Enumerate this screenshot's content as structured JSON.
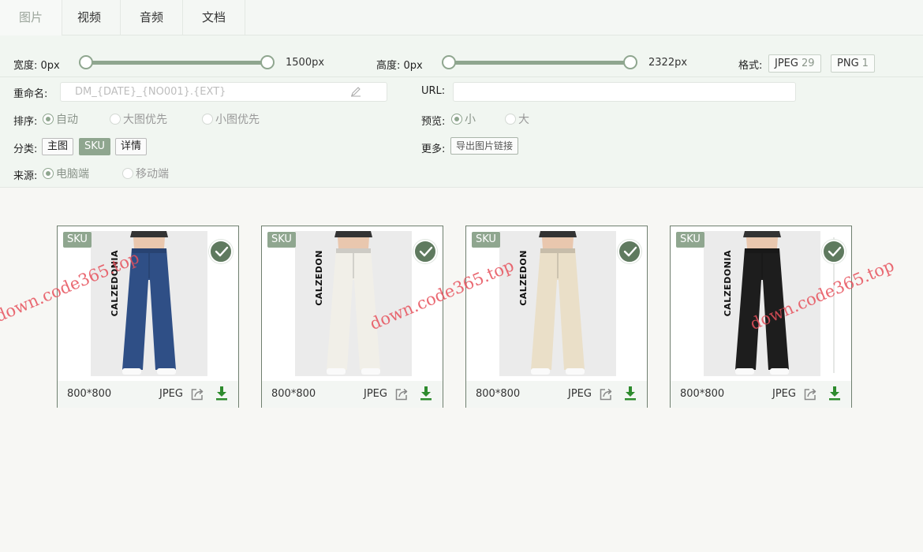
{
  "tabs": [
    {
      "label": "图片",
      "active": true
    },
    {
      "label": "视频",
      "active": false
    },
    {
      "label": "音频",
      "active": false
    },
    {
      "label": "文档",
      "active": false
    }
  ],
  "filters": {
    "width": {
      "label": "宽度: 0px",
      "max_label": "1500px",
      "min": 0,
      "max": 1500
    },
    "height": {
      "label": "高度: 0px",
      "max_label": "2322px",
      "min": 0,
      "max": 2322
    },
    "format": {
      "label": "格式:",
      "options": [
        {
          "name": "JPEG",
          "count": "29"
        },
        {
          "name": "PNG",
          "count": "1"
        }
      ]
    },
    "rename": {
      "label": "重命名:",
      "placeholder": "DM_{DATE}_{NO001}.{EXT}"
    },
    "url": {
      "label": "URL:",
      "value": ""
    },
    "sort": {
      "label": "排序:",
      "options": [
        {
          "label": "自动",
          "selected": true
        },
        {
          "label": "大图优先",
          "selected": false
        },
        {
          "label": "小图优先",
          "selected": false
        }
      ]
    },
    "preview": {
      "label": "预览:",
      "options": [
        {
          "label": "小",
          "selected": true
        },
        {
          "label": "大",
          "selected": false
        }
      ]
    },
    "category": {
      "label": "分类:",
      "options": [
        {
          "label": "主图",
          "active": false
        },
        {
          "label": "SKU",
          "active": true
        },
        {
          "label": "详情",
          "active": false
        }
      ]
    },
    "more": {
      "label": "更多:",
      "export_label": "导出图片链接"
    },
    "source": {
      "label": "来源:",
      "options": [
        {
          "label": "电脑端",
          "selected": true
        },
        {
          "label": "移动端",
          "selected": false
        }
      ]
    }
  },
  "images": [
    {
      "tag": "SKU",
      "brand": "CALZEDONIA",
      "dimensions": "800*800",
      "type": "JPEG",
      "checked": true,
      "pants_color": "#2f4f86"
    },
    {
      "tag": "SKU",
      "brand": "CALZEDON",
      "dimensions": "800*800",
      "type": "JPEG",
      "checked": true,
      "pants_color": "#f1efe8"
    },
    {
      "tag": "SKU",
      "brand": "CALZEDON",
      "dimensions": "800*800",
      "type": "JPEG",
      "checked": true,
      "pants_color": "#eadfc8"
    },
    {
      "tag": "SKU",
      "brand": "CALZEDONIA",
      "dimensions": "800*800",
      "type": "JPEG",
      "checked": true,
      "pants_color": "#1d1d1d"
    }
  ],
  "watermark_text": "down.code365.top",
  "colors": {
    "accent": "#8fa68f",
    "check": "#5f7a5f",
    "download": "#2e8b2e"
  }
}
